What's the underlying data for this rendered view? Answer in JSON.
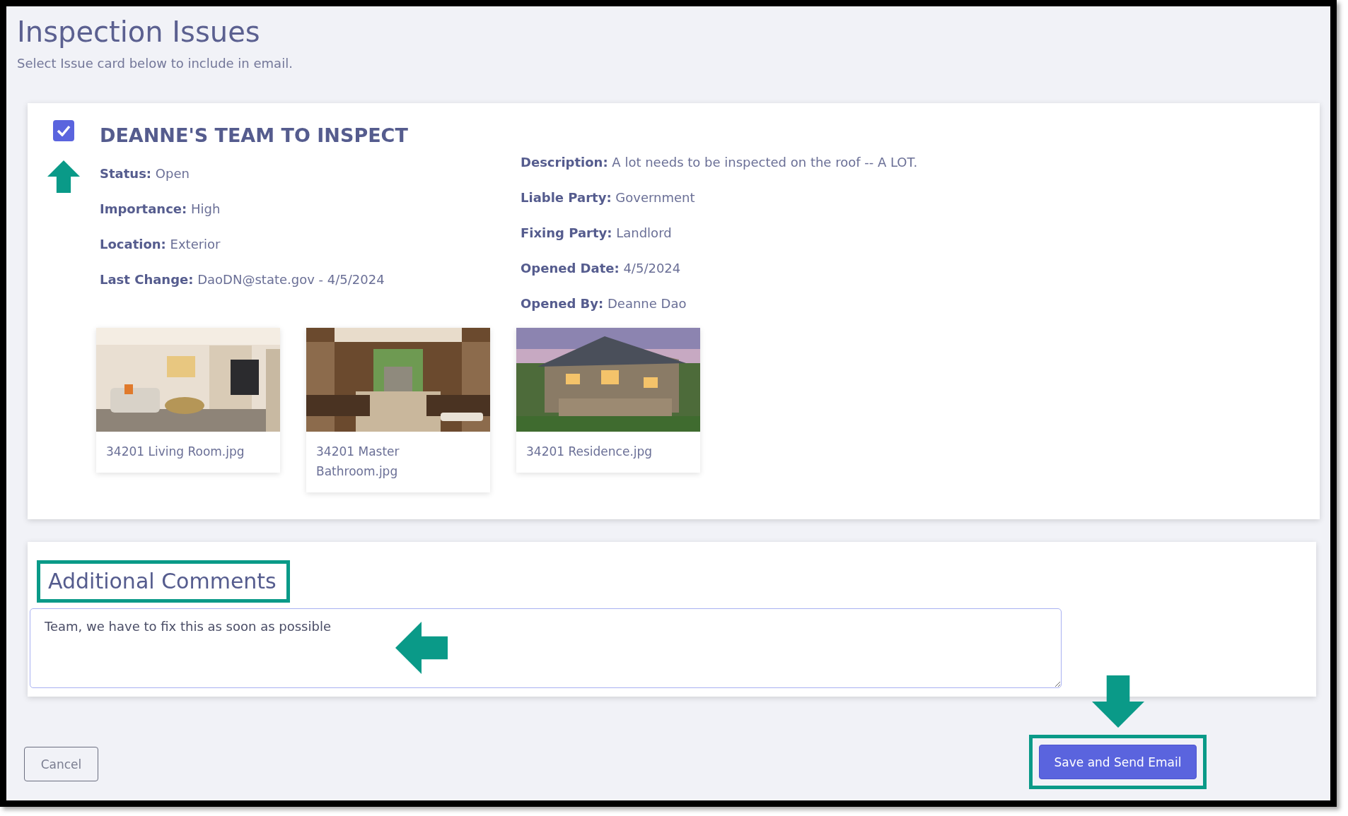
{
  "page": {
    "title": "Inspection Issues",
    "subtitle": "Select Issue card below to include in email."
  },
  "issue_card": {
    "checked": true,
    "pointed_at": true,
    "title": "DEANNE'S TEAM TO INSPECT",
    "left_details": [
      {
        "label": "Status:",
        "value": "Open"
      },
      {
        "label": "Importance:",
        "value": "High"
      },
      {
        "label": "Location:",
        "value": "Exterior"
      },
      {
        "label": "Last Change:",
        "value": "DaoDN@state.gov - 4/5/2024"
      }
    ],
    "right_details": [
      {
        "label": "Description:",
        "value": "A lot needs to be inspected on the roof -- A LOT."
      },
      {
        "label": "Liable Party:",
        "value": "Government"
      },
      {
        "label": "Fixing Party:",
        "value": "Landlord"
      },
      {
        "label": "Opened Date:",
        "value": "4/5/2024"
      },
      {
        "label": "Opened By:",
        "value": "Deanne Dao"
      }
    ],
    "photos": [
      {
        "kind": "picture",
        "caption": "34201 Living Room.jpg"
      },
      {
        "kind": "picture",
        "caption": "34201 Master Bathroom.jpg"
      },
      {
        "kind": "picture",
        "caption": "34201 Residence.jpg"
      }
    ]
  },
  "comments": {
    "heading": "Additional Comments",
    "highlighted": true,
    "value": "Team, we have to fix this as soon as possible",
    "pointed_at": true
  },
  "buttons": {
    "cancel": {
      "label": "Cancel"
    },
    "send": {
      "label": "Save and Send Email",
      "highlighted": true,
      "pointed_at": true
    }
  }
}
